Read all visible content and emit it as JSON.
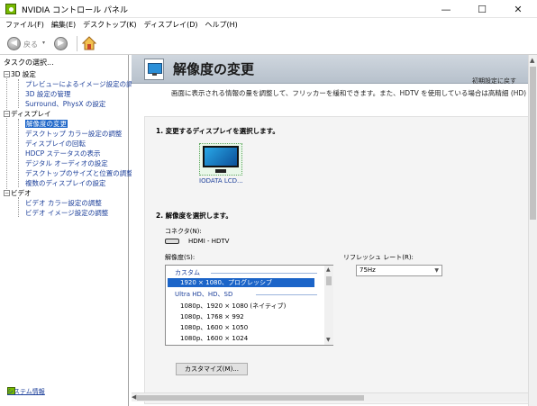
{
  "window": {
    "title": "NVIDIA コントロール パネル",
    "minimize_glyph": "—",
    "maximize_glyph": "☐",
    "close_glyph": "✕"
  },
  "menu": {
    "items": [
      "ファイル(F)",
      "編集(E)",
      "デスクトップ(K)",
      "ディスプレイ(D)",
      "ヘルプ(H)"
    ]
  },
  "toolbar": {
    "back_label": "戻る",
    "back_glyph": "◀",
    "forward_glyph": "▶",
    "caret_glyph": "▾"
  },
  "tasks": {
    "header": "タスクの選択...",
    "categories": [
      {
        "label": "3D 設定",
        "expander": "−",
        "items": [
          "プレビューによるイメージ設定の調整",
          "3D 設定の管理",
          "Surround、PhysX の設定"
        ]
      },
      {
        "label": "ディスプレイ",
        "expander": "−",
        "items": [
          "解像度の変更",
          "デスクトップ カラー設定の調整",
          "ディスプレイの回転",
          "HDCP ステータスの表示",
          "デジタル オーディオの設定",
          "デスクトップのサイズと位置の調整",
          "複数のディスプレイの設定"
        ]
      },
      {
        "label": "ビデオ",
        "expander": "−",
        "items": [
          "ビデオ カラー設定の調整",
          "ビデオ イメージ設定の調整"
        ]
      }
    ],
    "selected": "解像度の変更",
    "system_info": "システム情報"
  },
  "page": {
    "title": "解像度の変更",
    "restore_link": "初期設定に戻す",
    "description": "画面に表示される情報の量を調整して、フリッカーを緩和できます。また、HDTV を使用している場合は高精細 (HD) 方式を",
    "section1": "1. 変更するディスプレイを選択します。",
    "monitor_name": "IODATA LCD...",
    "section2": "2. 解像度を選択します。",
    "connector_label": "コネクタ(N):",
    "connector_value": "HDMI - HDTV",
    "resolution_label": "解像度(S):",
    "refresh_label": "リフレッシュ レート(R):",
    "refresh_value": "75Hz",
    "customize_button": "カスタマイズ(M)...",
    "resolution_list": {
      "custom_group": "カスタム",
      "custom_items": [
        "1920 × 1080、プログレッシブ"
      ],
      "uhd_group": "Ultra HD、HD、SD",
      "uhd_items": [
        "1080p、1920 × 1080 (ネイティブ)",
        "1080p、1768 × 992",
        "1080p、1600 × 1050",
        "1080p、1600 × 1024"
      ]
    }
  },
  "colors": {
    "nvidia_green": "#76b900",
    "selection_blue": "#1b64c8",
    "link_blue": "#1c3f9a"
  }
}
